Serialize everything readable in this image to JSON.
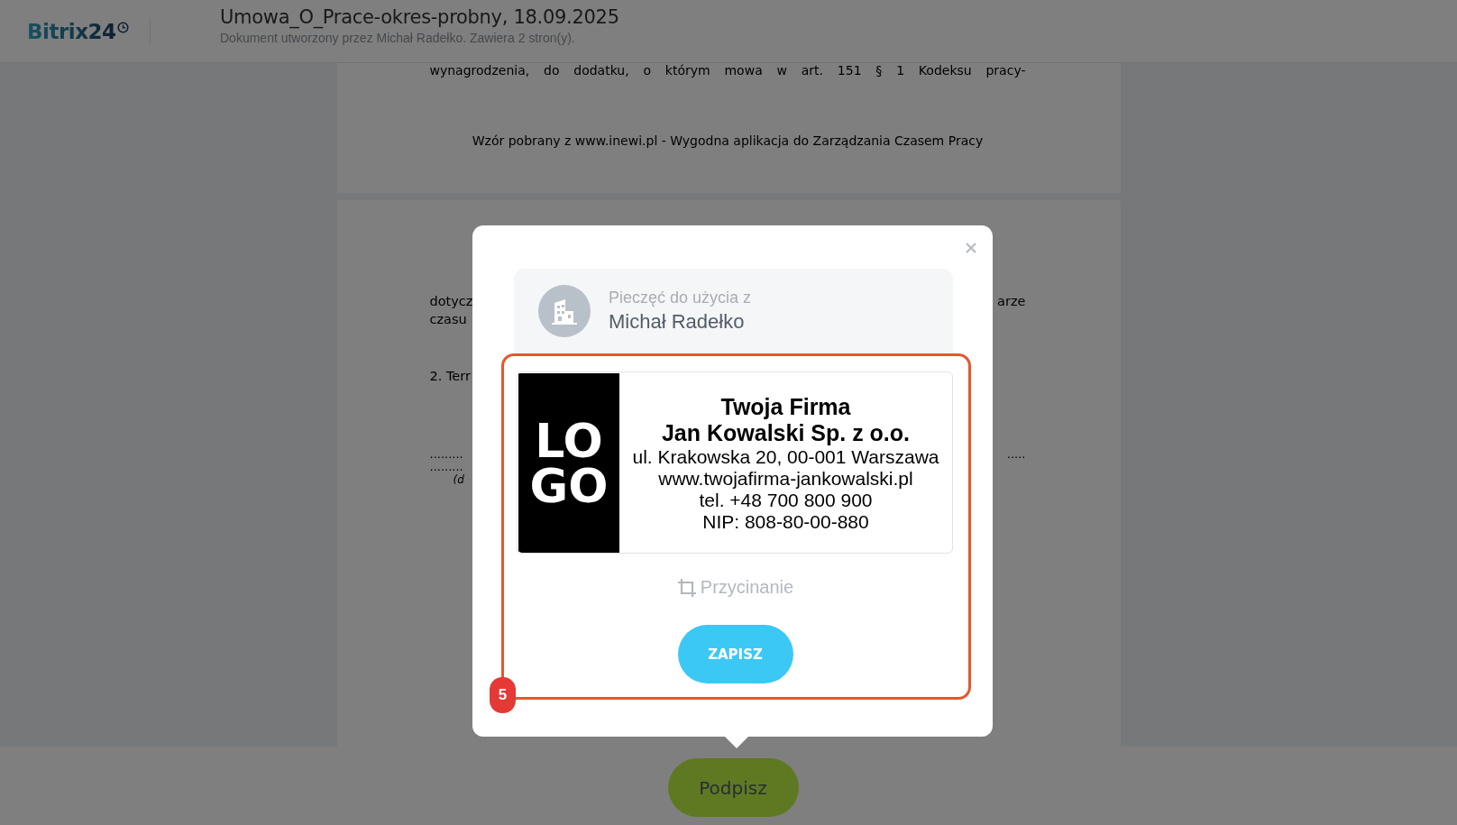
{
  "header": {
    "logo": "Bitrix24",
    "title": "Umowa_O_Prace-okres-probny, 18.09.2025",
    "subtitle": "Dokument utworzony przez Michał Radełko. Zawiera 2 stron(y)."
  },
  "document": {
    "page_1": {
      "last_line": "wynagrodzenia, do dodatku, o którym mowa w art. 151 § 1 Kodeksu pracy-",
      "footer": "Wzór pobrany z www.inewi.pl - Wygodna aplikacja do Zarządzania Czasem Pracy"
    },
    "page_2": {
      "rows": [
        {
          "left": "dotycz",
          "right": "arze",
          "kind": "text"
        },
        {
          "left": "czasu",
          "kind": "text"
        },
        {
          "left": "2. Terr",
          "kind": "heading"
        },
        {
          "left": ".........",
          "right": ".....",
          "kind": "dots"
        },
        {
          "left": ".........",
          "kind": "dots"
        },
        {
          "left": "(d",
          "kind": "caption"
        }
      ]
    }
  },
  "stamp_dialog": {
    "label": "Pieczęć do użycia z",
    "owner": "Michał Radełko",
    "stamp": {
      "logo_lines": [
        "LO",
        "GO"
      ],
      "lines": [
        {
          "text": "Twoja Firma",
          "kind": "heading"
        },
        {
          "text": "Jan Kowalski Sp. z o.o.",
          "kind": "heading"
        },
        {
          "text": "ul. Krakowska 20, 00-001 Warszawa",
          "kind": "detail"
        },
        {
          "text": "www.twojafirma-jankowalski.pl",
          "kind": "detail"
        },
        {
          "text": "tel. +48 700 800 900",
          "kind": "detail"
        },
        {
          "text": "NIP: 808-80-00-880",
          "kind": "detail"
        }
      ]
    },
    "crop_link": "Przycinanie",
    "save_button": "ZAPISZ",
    "step_badge": "5"
  },
  "sign_button": "Podpisz"
}
